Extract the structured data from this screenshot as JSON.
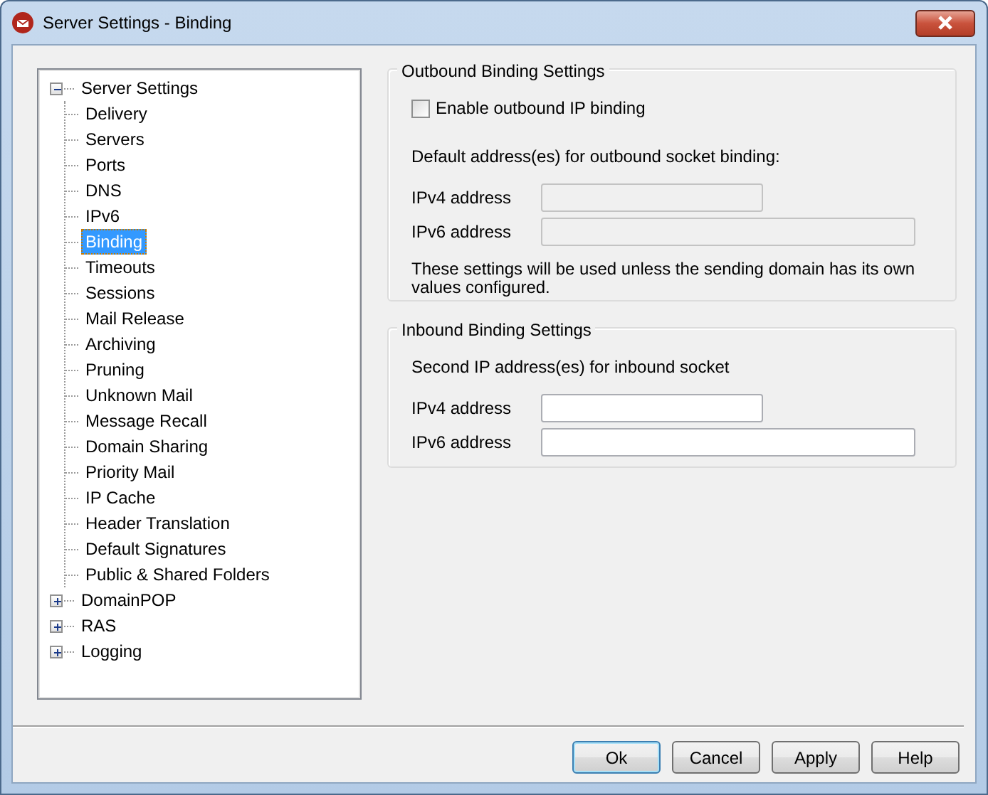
{
  "window": {
    "title": "Server Settings - Binding"
  },
  "tree": [
    {
      "label": "Server Settings",
      "expanded": true,
      "selected": false,
      "children": [
        {
          "label": "Delivery",
          "selected": false
        },
        {
          "label": "Servers",
          "selected": false
        },
        {
          "label": "Ports",
          "selected": false
        },
        {
          "label": "DNS",
          "selected": false
        },
        {
          "label": "IPv6",
          "selected": false
        },
        {
          "label": "Binding",
          "selected": true
        },
        {
          "label": "Timeouts",
          "selected": false
        },
        {
          "label": "Sessions",
          "selected": false
        },
        {
          "label": "Mail Release",
          "selected": false
        },
        {
          "label": "Archiving",
          "selected": false
        },
        {
          "label": "Pruning",
          "selected": false
        },
        {
          "label": "Unknown Mail",
          "selected": false
        },
        {
          "label": "Message Recall",
          "selected": false
        },
        {
          "label": "Domain Sharing",
          "selected": false
        },
        {
          "label": "Priority Mail",
          "selected": false
        },
        {
          "label": "IP Cache",
          "selected": false
        },
        {
          "label": "Header Translation",
          "selected": false
        },
        {
          "label": "Default Signatures",
          "selected": false
        },
        {
          "label": "Public & Shared Folders",
          "selected": false
        }
      ]
    },
    {
      "label": "DomainPOP",
      "expanded": false,
      "selected": false
    },
    {
      "label": "RAS",
      "expanded": false,
      "selected": false
    },
    {
      "label": "Logging",
      "expanded": false,
      "selected": false
    }
  ],
  "outbound": {
    "title": "Outbound Binding Settings",
    "checkbox": {
      "label": "Enable outbound IP binding",
      "checked": false
    },
    "intro": "Default address(es) for outbound socket binding:",
    "fields": [
      {
        "label": "IPv4 address",
        "disabled": true,
        "kind": "short"
      },
      {
        "label": "IPv6 address",
        "disabled": true,
        "kind": "long"
      }
    ],
    "note": "These settings will be used unless the sending domain has its own values configured."
  },
  "inbound": {
    "title": "Inbound Binding Settings",
    "intro": "Second IP address(es) for inbound socket",
    "fields": [
      {
        "label": "IPv4 address",
        "disabled": false,
        "kind": "short"
      },
      {
        "label": "IPv6 address",
        "disabled": false,
        "kind": "long"
      }
    ]
  },
  "buttons": [
    {
      "label": "Ok",
      "default": true
    },
    {
      "label": "Cancel",
      "default": false
    },
    {
      "label": "Apply",
      "default": false
    },
    {
      "label": "Help",
      "default": false
    }
  ]
}
